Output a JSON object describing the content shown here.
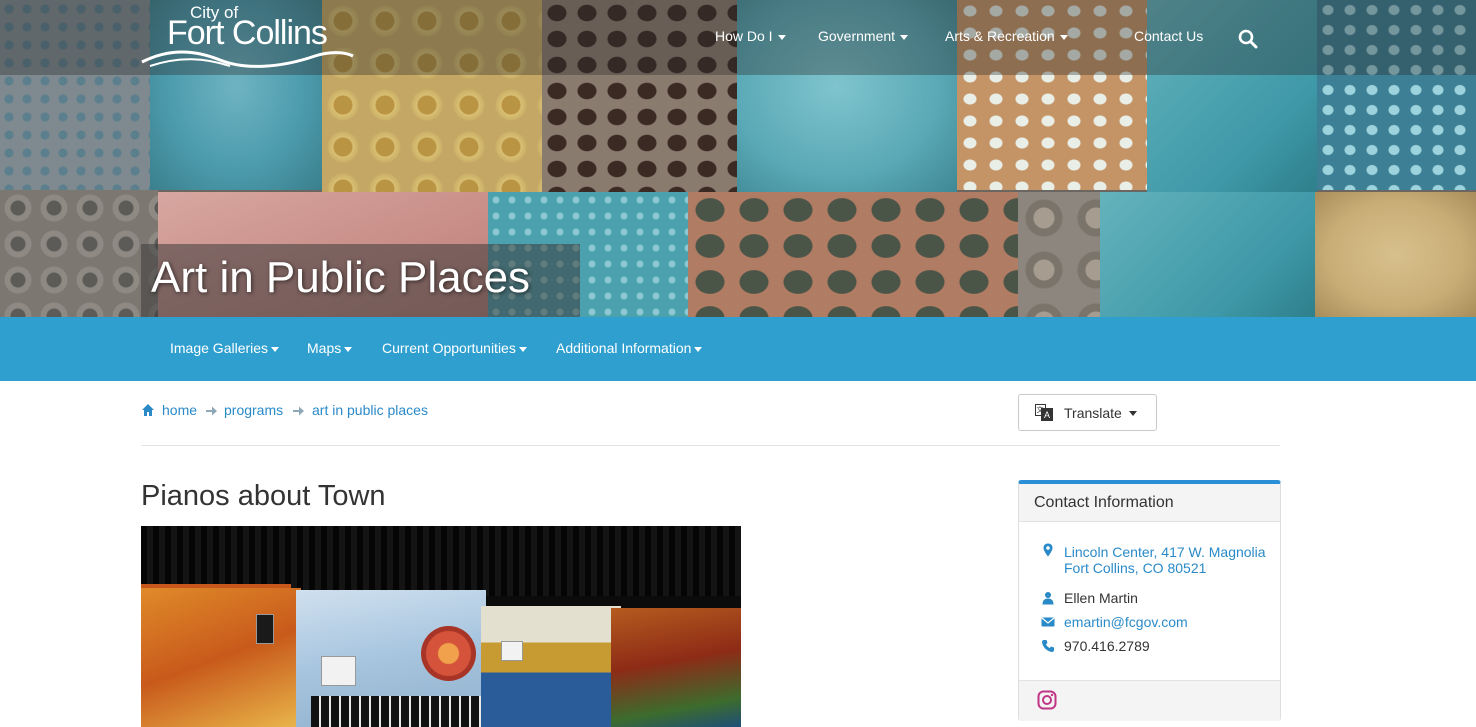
{
  "header": {
    "logo": {
      "top": "City of",
      "main": "Fort Collins"
    },
    "nav": [
      {
        "label": "How Do I",
        "has_caret": true
      },
      {
        "label": "Government",
        "has_caret": true
      },
      {
        "label": "Arts & Recreation",
        "has_caret": true
      },
      {
        "label": "Contact Us",
        "has_caret": false
      }
    ],
    "search_icon": "search-icon"
  },
  "hero": {
    "title": "Art in Public Places"
  },
  "subnav": {
    "items": [
      {
        "label": "Image Galleries"
      },
      {
        "label": "Maps"
      },
      {
        "label": "Current Opportunities"
      },
      {
        "label": "Additional Information"
      }
    ]
  },
  "breadcrumb": {
    "home": "home",
    "items": [
      "programs",
      "art in public places"
    ]
  },
  "translate": {
    "label": "Translate"
  },
  "main": {
    "title": "Pianos about Town"
  },
  "contact": {
    "title": "Contact Information",
    "address_line1": "Lincoln Center, 417 W. Magnolia",
    "address_line2": "Fort Collins, CO 80521",
    "person": "Ellen Martin",
    "email": "emartin@fcgov.com",
    "phone": "970.416.2789"
  },
  "colors": {
    "accent_blue": "#2e9fcf",
    "link_blue": "#2a8ac8",
    "card_top_border": "#2a8fd6",
    "instagram": "#c13584"
  }
}
